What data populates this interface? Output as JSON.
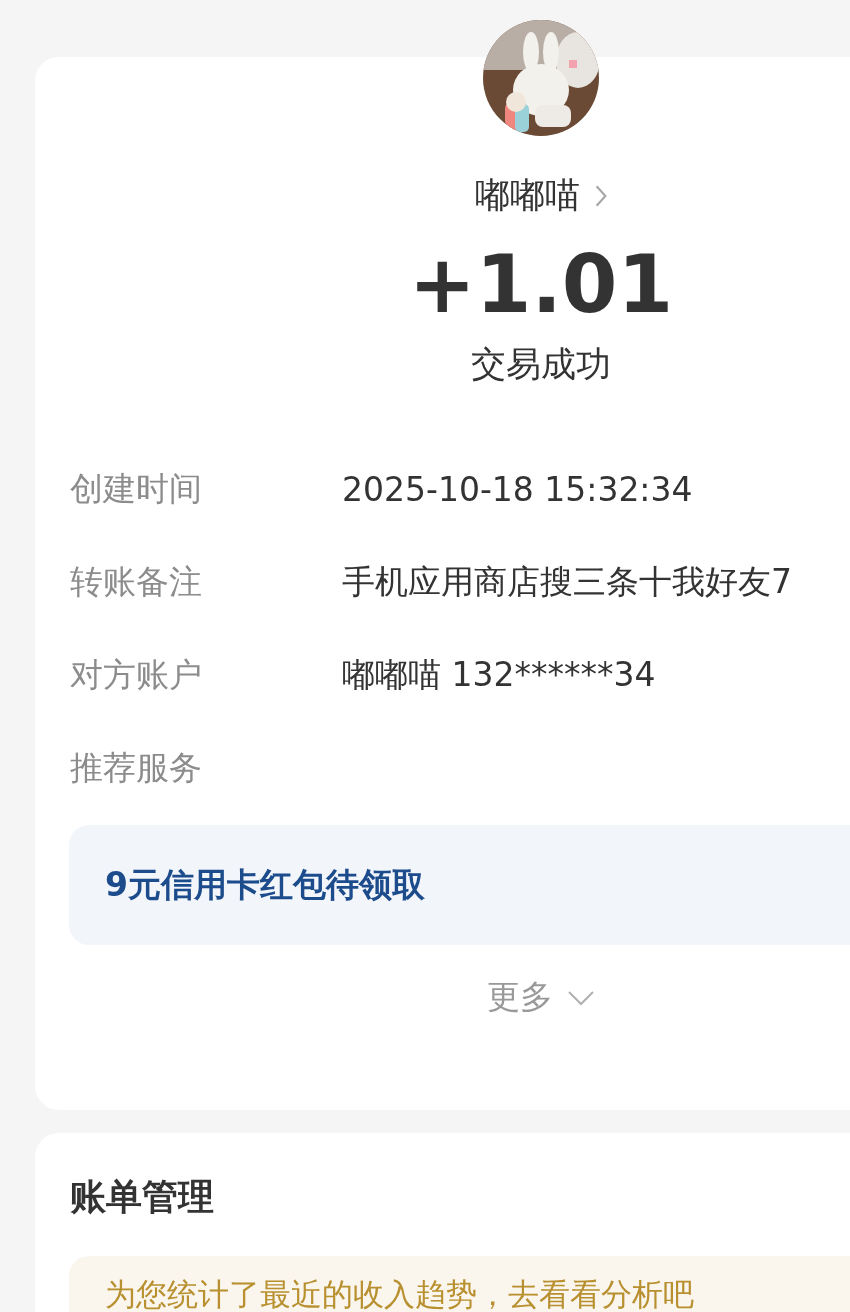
{
  "payee": {
    "name": "嘟嘟喵"
  },
  "amount": "+1.01",
  "status": "交易成功",
  "details": [
    {
      "label": "创建时间",
      "value": "2025-10-18 15:32:34"
    },
    {
      "label": "转账备注",
      "value": "手机应用商店搜三条十我好友7"
    },
    {
      "label": "对方账户",
      "value": "嘟嘟喵 132******34"
    },
    {
      "label": "推荐服务"
    }
  ],
  "recommendation": "9元信用卡红包待领取",
  "more": "更多",
  "bill_management": {
    "title": "账单管理",
    "banner": "为您统计了最近的收入趋势，去看看分析吧"
  }
}
